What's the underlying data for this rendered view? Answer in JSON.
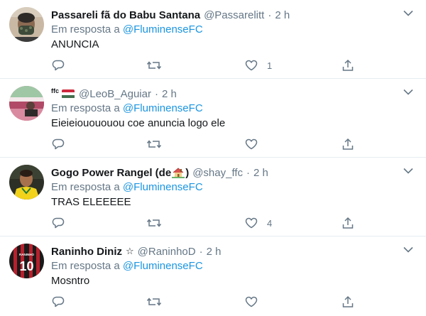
{
  "tweets": [
    {
      "display_name": "Passareli fã do Babu Santana",
      "handle": "@Passarelitt",
      "time": "2 h",
      "reply_prefix": "Em resposta a",
      "reply_to": "@FluminenseFC",
      "text": "ANUNCIA",
      "reply_count": "",
      "retweet_count": "",
      "like_count": "1"
    },
    {
      "display_name_prefix": "ffc",
      "handle": "@LeoB_Aguiar",
      "time": "2 h",
      "reply_prefix": "Em resposta a",
      "reply_to": "@FluminenseFC",
      "text": "Eieieiouououou coe anuncia logo ele",
      "flag_colors": [
        "#cd2a3e",
        "#ffffff",
        "#436f4d"
      ],
      "reply_count": "",
      "retweet_count": "",
      "like_count": ""
    },
    {
      "display_name_start": "Gogo Power Rangel (de",
      "display_name_end": ")",
      "handle": "@shay_ffc",
      "time": "2 h",
      "reply_prefix": "Em resposta a",
      "reply_to": "@FluminenseFC",
      "text": "TRAS ELEEEEE",
      "reply_count": "",
      "retweet_count": "",
      "like_count": "4"
    },
    {
      "display_name": "Raninho Diniz",
      "star": "☆",
      "handle": "@RaninhoD",
      "time": "2 h",
      "reply_prefix": "Em resposta a",
      "reply_to": "@FluminenseFC",
      "text": "Mosntro",
      "avatar_shirt_number": "10",
      "reply_count": "",
      "retweet_count": "",
      "like_count": ""
    }
  ],
  "separator": "·",
  "icons": {
    "reply": "reply-icon",
    "retweet": "retweet-icon",
    "like": "heart-icon",
    "share": "share-icon",
    "more": "chevron-down-icon"
  },
  "colors": {
    "text": "#14171a",
    "secondary": "#657786",
    "link": "#1b95e0",
    "divider": "#e6ecf0"
  }
}
